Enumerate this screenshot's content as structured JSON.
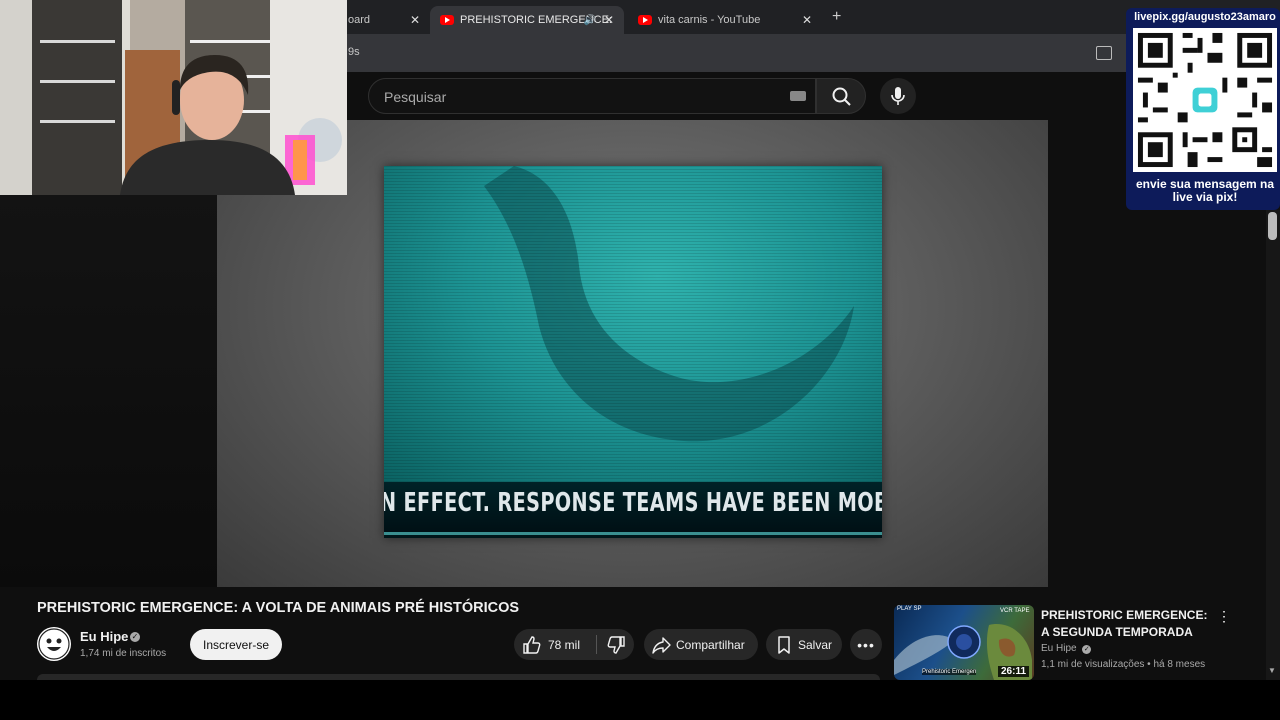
{
  "browser": {
    "tabs": [
      {
        "label": "oard",
        "active": false
      },
      {
        "label": "PREHISTORIC EMERGENCE:",
        "active": true
      },
      {
        "label": "vita carnis - YouTube",
        "active": false
      }
    ],
    "new_tab": "+",
    "close": "✕",
    "address_fragment": "9s"
  },
  "search": {
    "placeholder": "Pesquisar"
  },
  "player": {
    "ticker_text": "N EFFECT. RESPONSE TEAMS HAVE BEEN MOBILIZED"
  },
  "overlay": {
    "qr_url": "livepix.gg/augusto23amaro",
    "message": "envie sua mensagem na live via pix!"
  },
  "video": {
    "title": "PREHISTORIC EMERGENCE: A VOLTA DE ANIMAIS PRÉ HISTÓRICOS",
    "channel": "Eu Hipe",
    "subscribers": "1,74 mi de inscritos",
    "subscribe_label": "Inscrever-se",
    "likes": "78 mil",
    "share_label": "Compartilhar",
    "save_label": "Salvar"
  },
  "related": {
    "title": "PREHISTORIC EMERGENCE: A SEGUNDA TEMPORADA",
    "channel": "Eu Hipe",
    "meta": "1,1 mi de visualizações • há 8 meses",
    "duration": "26:11",
    "thumb_tag_left": "PLAY SP",
    "thumb_tag_right": "VCR TAPE",
    "thumb_caption": "Prehistoric Emergen"
  },
  "colors": {
    "background": "#0f0f0f",
    "accent_red": "#ff0000",
    "overlay_blue": "#0d1b5a",
    "screen_teal": "#1c9393"
  }
}
